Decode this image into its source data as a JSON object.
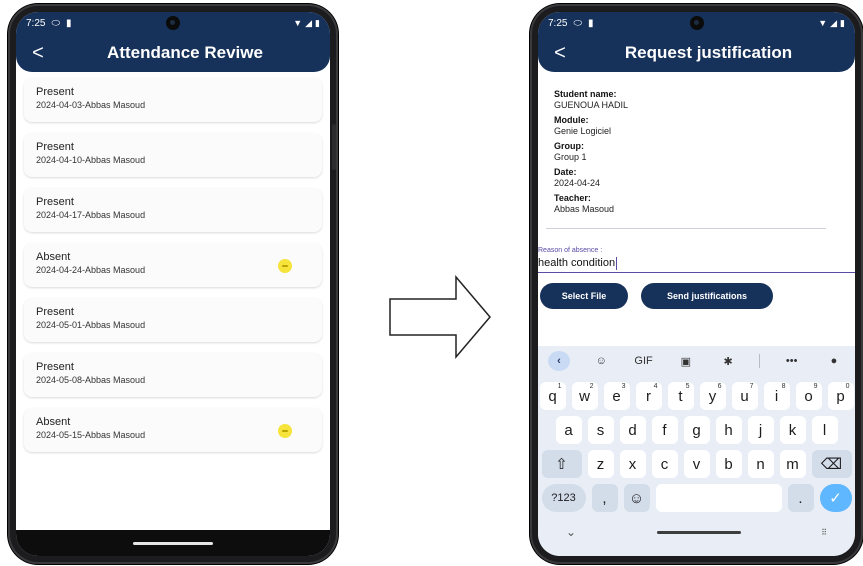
{
  "left_screen": {
    "status_time": "7:25",
    "title": "Attendance Reviwe",
    "records": [
      {
        "status": "Present",
        "meta": "2024-04-03-Abbas Masoud",
        "flag": false
      },
      {
        "status": "Present",
        "meta": "2024-04-10-Abbas Masoud",
        "flag": false
      },
      {
        "status": "Present",
        "meta": "2024-04-17-Abbas Masoud",
        "flag": false
      },
      {
        "status": "Absent",
        "meta": "2024-04-24-Abbas Masoud",
        "flag": true
      },
      {
        "status": "Present",
        "meta": "2024-05-01-Abbas Masoud",
        "flag": false
      },
      {
        "status": "Present",
        "meta": "2024-05-08-Abbas Masoud",
        "flag": false
      },
      {
        "status": "Absent",
        "meta": "2024-05-15-Abbas Masoud",
        "flag": true
      }
    ],
    "accent_color": "#16315a",
    "flag_color": "#f6e33b"
  },
  "right_screen": {
    "status_time": "7:25",
    "title": "Request justification",
    "student_label": "Student name:",
    "student_value": "GUENOUA HADIL",
    "module_label": "Module:",
    "module_value": "Genie Logiciel",
    "group_label": "Group:",
    "group_value": "Group 1",
    "date_label": "Date:",
    "date_value": "2024-04-24",
    "teacher_label": "Teacher:",
    "teacher_value": "Abbas Masoud",
    "reason_label": "Reason of absence :",
    "reason_value": "health condition",
    "select_file_label": "Select File",
    "send_label": "Send justifications",
    "keyboard": {
      "toolbar": [
        "back-icon",
        "sticker-icon",
        "GIF",
        "clipboard-icon",
        "settings-icon",
        "more-icon",
        "mic-icon"
      ],
      "row1": [
        "q",
        "w",
        "e",
        "r",
        "t",
        "y",
        "u",
        "i",
        "o",
        "p"
      ],
      "row1_hints": [
        "1",
        "2",
        "3",
        "4",
        "5",
        "6",
        "7",
        "8",
        "9",
        "0"
      ],
      "row2": [
        "a",
        "s",
        "d",
        "f",
        "g",
        "h",
        "j",
        "k",
        "l"
      ],
      "row3": [
        "z",
        "x",
        "c",
        "v",
        "b",
        "n",
        "m"
      ],
      "num_key": "?123",
      "comma_key": ",",
      "period_key": "."
    }
  }
}
